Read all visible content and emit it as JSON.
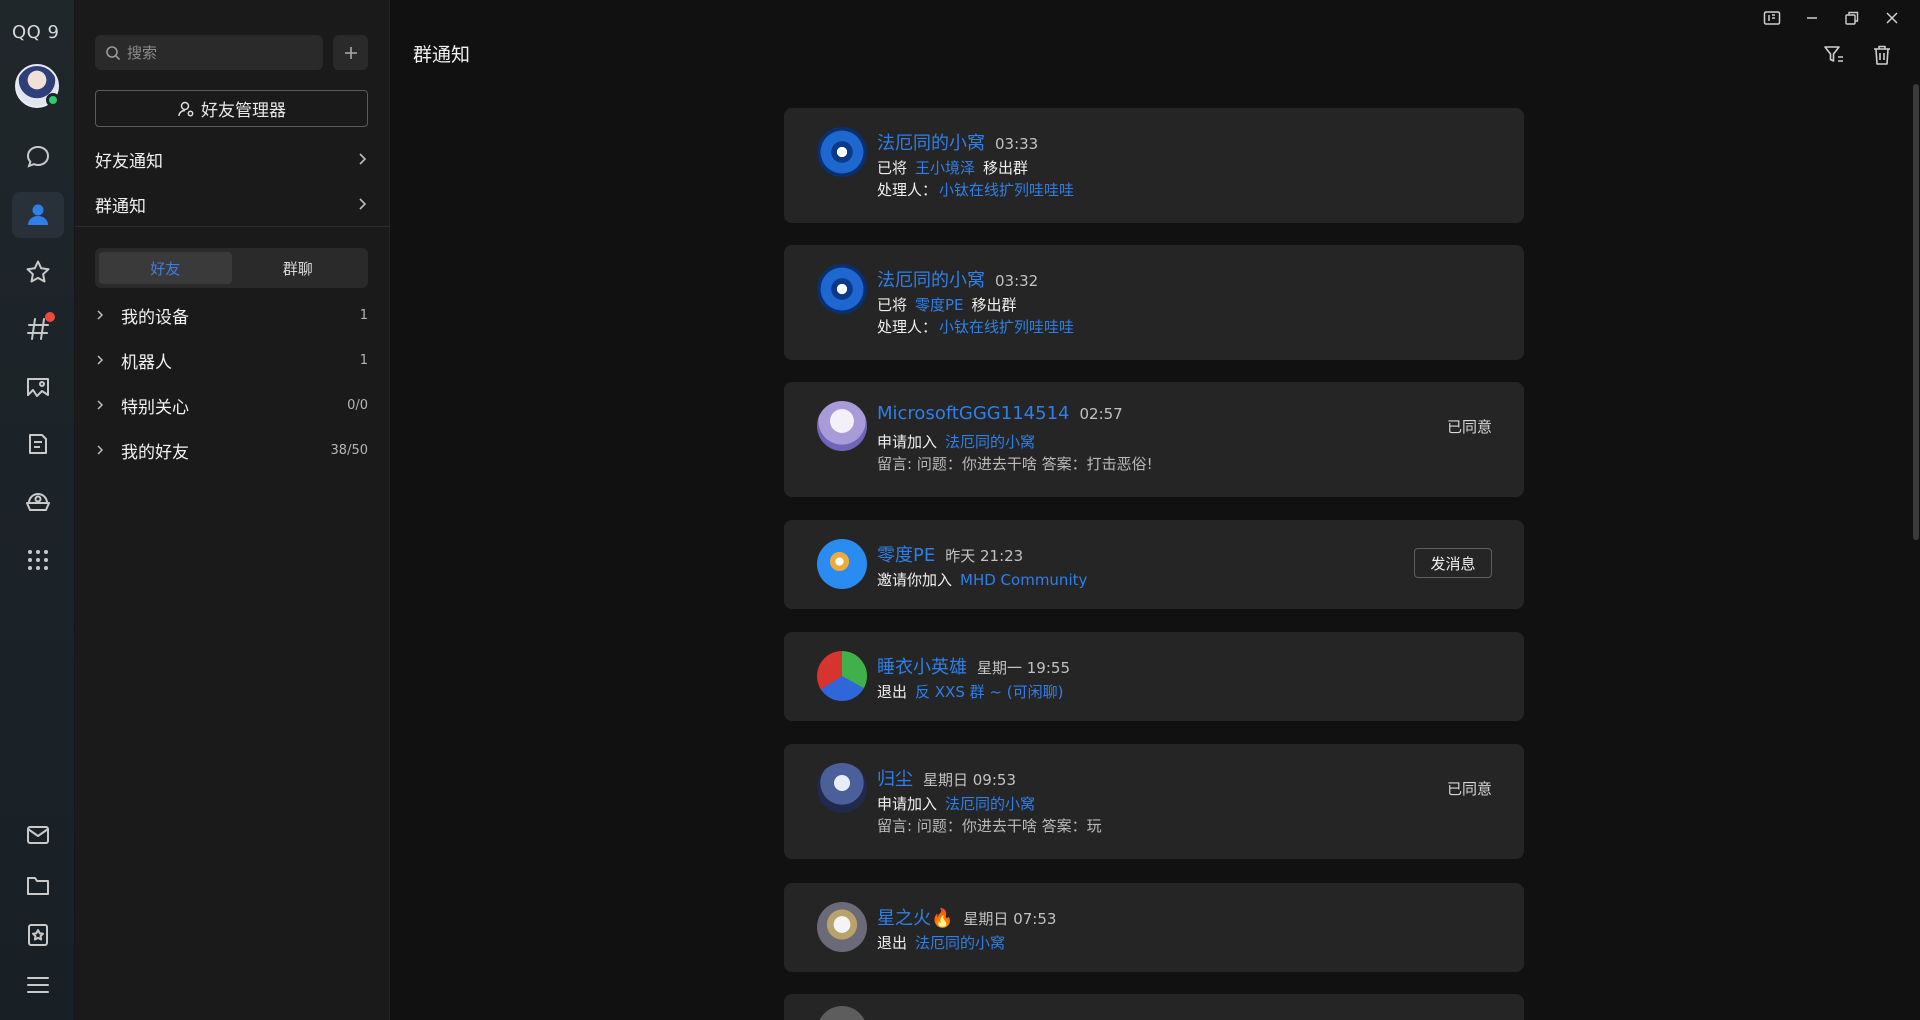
{
  "app": {
    "logo": "QQ 9"
  },
  "colors": {
    "accent": "#2f7fe8",
    "badge_red": "#f0483d",
    "online_green": "#2ecc71",
    "card_bg": "#252525",
    "page_bg": "#111111"
  },
  "rail": {
    "items": [
      {
        "icon": "chat-bubble-icon"
      },
      {
        "icon": "contacts-icon",
        "active": true
      },
      {
        "icon": "star-icon"
      },
      {
        "icon": "channel-hash-icon",
        "badge": true
      },
      {
        "icon": "photo-wall-icon"
      },
      {
        "icon": "notes-icon"
      },
      {
        "icon": "mini-app-icon"
      },
      {
        "icon": "apps-grid-icon"
      }
    ],
    "bottom_items": [
      {
        "icon": "mail-icon"
      },
      {
        "icon": "folder-icon"
      },
      {
        "icon": "favorites-icon"
      },
      {
        "icon": "menu-icon"
      }
    ]
  },
  "panel": {
    "search_placeholder": "搜索",
    "add_label": "+",
    "friend_manager_label": "好友管理器",
    "nav": [
      {
        "label": "好友通知"
      },
      {
        "label": "群通知"
      }
    ],
    "tabs": [
      {
        "label": "好友",
        "active": true
      },
      {
        "label": "群聊",
        "active": false
      }
    ],
    "groups": [
      {
        "name": "我的设备",
        "count": "1"
      },
      {
        "name": "机器人",
        "count": "1"
      },
      {
        "name": "特别关心",
        "count": "0/0"
      },
      {
        "name": "我的好友",
        "count": "38/50"
      }
    ]
  },
  "main": {
    "title": "群通知",
    "notices": [
      {
        "sender": "法厄同的小窝",
        "time": "03:33",
        "action": "已将",
        "target": "王小境泽",
        "action_suffix": "移出群",
        "handler_label": "处理人：",
        "handler": "小钛在线扩列哇哇哇"
      },
      {
        "sender": "法厄同的小窝",
        "time": "03:32",
        "action": "已将",
        "target": "零度PE",
        "action_suffix": "移出群",
        "handler_label": "处理人：",
        "handler": "小钛在线扩列哇哇哇"
      },
      {
        "sender": "MicrosoftGGG114514",
        "time": "02:57",
        "action": "申请加入",
        "target": "法厄同的小窝",
        "message": "留言: 问题：你进去干啥 答案：打击恶俗!",
        "status": "已同意"
      },
      {
        "sender": "零度PE",
        "time": "昨天 21:23",
        "action": "邀请你加入",
        "target": "MHD Community",
        "button": "发消息"
      },
      {
        "sender": "睡衣小英雄",
        "time": "星期一 19:55",
        "action": "退出",
        "target": "反 XXS 群 ~ (可闲聊)"
      },
      {
        "sender": "归尘",
        "time": "星期日 09:53",
        "action": "申请加入",
        "target": "法厄同的小窝",
        "message": "留言: 问题：你进去干啥 答案：玩",
        "status": "已同意"
      },
      {
        "sender": "星之火🔥",
        "time": "星期日 07:53",
        "action": "退出",
        "target": "法厄同的小窝"
      }
    ]
  }
}
